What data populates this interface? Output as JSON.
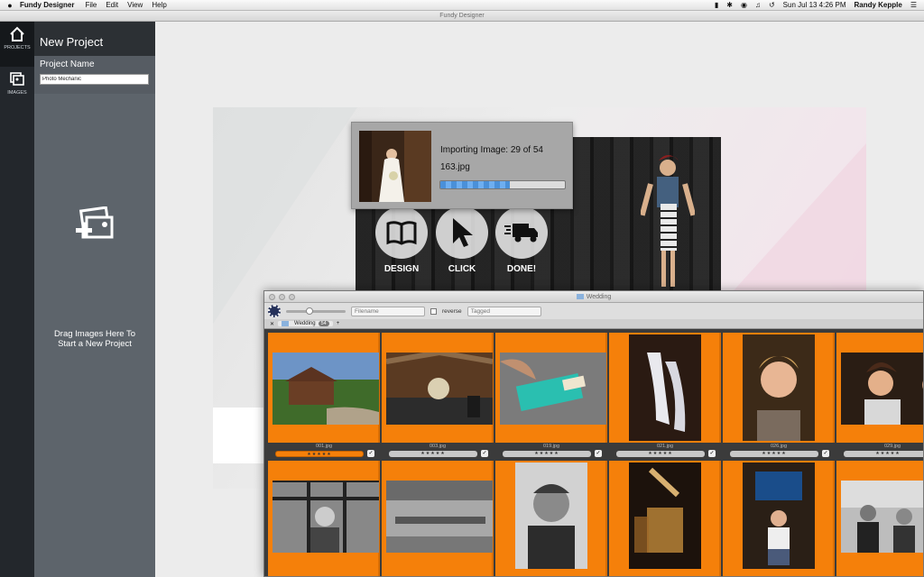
{
  "menubar": {
    "apple": "",
    "app_name": "Fundy Designer",
    "menus": [
      "File",
      "Edit",
      "View",
      "Help"
    ],
    "clock": "Sun Jul 13  4:26 PM",
    "user": "Randy Kepple"
  },
  "window": {
    "title": "Fundy Designer"
  },
  "rail": {
    "items": [
      {
        "label": "PROJECTS",
        "icon": "home-icon"
      },
      {
        "label": "IMAGES",
        "icon": "images-icon"
      }
    ]
  },
  "panel": {
    "title": "New Project",
    "name_label": "Project Name",
    "name_value": "Photo Mechanic",
    "drop_text": "Drag Images Here To Start a New Project"
  },
  "hero": {
    "buttons": [
      {
        "label": "DESIGN",
        "icon": "book-icon"
      },
      {
        "label": "CLICK",
        "icon": "cursor-icon"
      },
      {
        "label": "DONE!",
        "icon": "truck-icon"
      }
    ]
  },
  "import_dialog": {
    "status": "Importing Image: 29 of 54",
    "filename": "163.jpg",
    "progress": 0.56
  },
  "photo_mechanic": {
    "title": "Wedding",
    "sort_select": "Filename",
    "reverse_label": "reverse",
    "filter_select": "Tagged",
    "tab_label": "Wedding",
    "tab_count": "54",
    "add_tab": "+",
    "thumbnails": [
      {
        "name": "001.jpg",
        "stars": "★★★★★",
        "rated": true
      },
      {
        "name": "003.jpg",
        "stars": "★★★★★",
        "rated": false
      },
      {
        "name": "019.jpg",
        "stars": "★★★★★",
        "rated": false
      },
      {
        "name": "021.jpg",
        "stars": "★★★★★",
        "rated": false
      },
      {
        "name": "026.jpg",
        "stars": "★★★★★",
        "rated": false
      },
      {
        "name": "029.jpg",
        "stars": "★★★★★",
        "rated": false
      },
      {
        "name": "",
        "stars": "",
        "rated": false
      },
      {
        "name": "",
        "stars": "",
        "rated": false
      },
      {
        "name": "",
        "stars": "",
        "rated": false
      },
      {
        "name": "",
        "stars": "",
        "rated": false
      },
      {
        "name": "",
        "stars": "",
        "rated": false
      },
      {
        "name": "",
        "stars": "",
        "rated": false
      }
    ]
  },
  "colors": {
    "rail_bg": "#23272c",
    "panel_bg": "#565c63",
    "pm_cell": "#f5800a",
    "progress": "#4a90d9"
  }
}
